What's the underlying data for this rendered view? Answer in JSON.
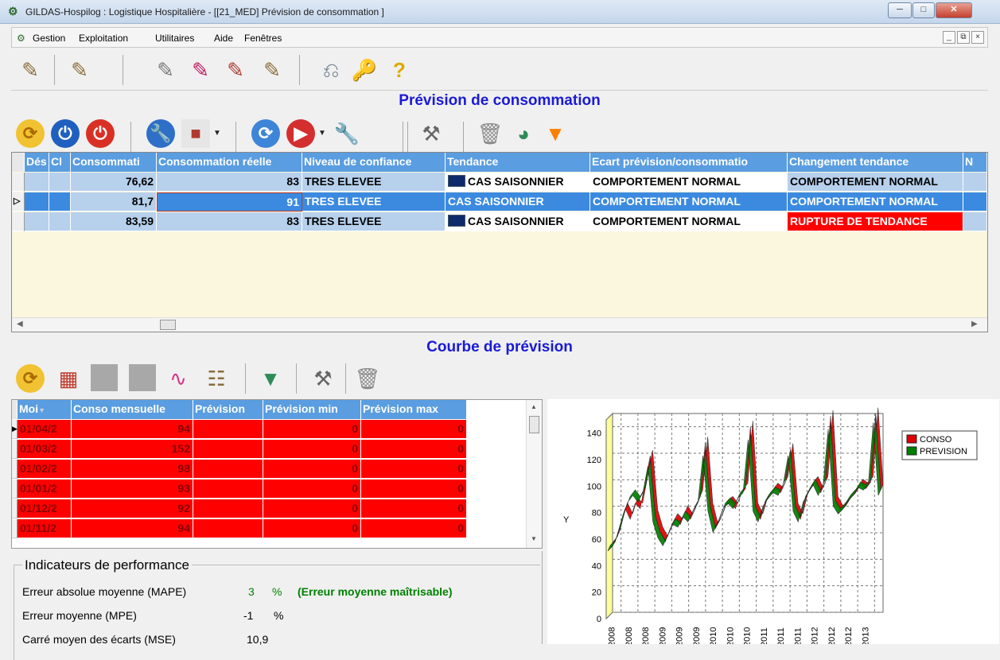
{
  "window": {
    "title": "GILDAS-Hospilog : Logistique Hospitalière - [[21_MED] Prévision de consommation ]"
  },
  "menu": [
    "Gestion",
    "Exploitation",
    "Utilitaires",
    "Aide",
    "Fenêtres"
  ],
  "section1_title": "Prévision de consommation",
  "grid1": {
    "headers": [
      "Dés",
      "Cl",
      "Consommati",
      "Consommation réelle",
      "Niveau de confiance",
      "Tendance",
      "Ecart prévision/consommatio",
      "Changement tendance",
      "N"
    ],
    "rows": [
      {
        "consommation": "76,62",
        "reelle": "83",
        "confiance": "TRES ELEVEE",
        "tendance": "CAS SAISONNIER",
        "ecart": "COMPORTEMENT NORMAL",
        "changement": "COMPORTEMENT NORMAL"
      },
      {
        "consommation": "81,7",
        "reelle": "91",
        "confiance": "TRES ELEVEE",
        "tendance": "CAS SAISONNIER",
        "ecart": "COMPORTEMENT NORMAL",
        "changement": "COMPORTEMENT NORMAL"
      },
      {
        "consommation": "83,59",
        "reelle": "83",
        "confiance": "TRES ELEVEE",
        "tendance": "CAS SAISONNIER",
        "ecart": "COMPORTEMENT NORMAL",
        "changement": "RUPTURE DE TENDANCE"
      }
    ]
  },
  "section2_title": "Courbe de prévision",
  "grid2": {
    "headers": [
      "Moi",
      "Conso mensuelle",
      "Prévision",
      "Prévision min",
      "Prévision max"
    ],
    "rows": [
      {
        "mois": "01/04/2",
        "conso": "94",
        "prevision": "",
        "min": "0",
        "max": "0"
      },
      {
        "mois": "01/03/2",
        "conso": "152",
        "prevision": "",
        "min": "0",
        "max": "0"
      },
      {
        "mois": "01/02/2",
        "conso": "98",
        "prevision": "",
        "min": "0",
        "max": "0"
      },
      {
        "mois": "01/01/2",
        "conso": "93",
        "prevision": "",
        "min": "0",
        "max": "0"
      },
      {
        "mois": "01/12/2",
        "conso": "92",
        "prevision": "",
        "min": "0",
        "max": "0"
      },
      {
        "mois": "01/11/2",
        "conso": "94",
        "prevision": "",
        "min": "0",
        "max": "0"
      }
    ]
  },
  "perf": {
    "title": "Indicateurs de performance",
    "mape_label": "Erreur absolue moyenne (MAPE)",
    "mape_value": "3",
    "mape_unit": "%",
    "mape_comment": "(Erreur moyenne maîtrisable)",
    "mpe_label": "Erreur moyenne (MPE)",
    "mpe_value": "-1",
    "mpe_unit": "%",
    "mse_label": "Carré moyen des écarts (MSE)",
    "mse_value": "10,9"
  },
  "colors": {
    "accent_blue": "#1a1ad6",
    "header_blue": "#5a9de0",
    "red": "#ff0000",
    "green": "#008000"
  },
  "chart_data": {
    "type": "line",
    "ylabel": "Y",
    "ylim": [
      0,
      150
    ],
    "yticks": [
      0,
      20,
      40,
      60,
      80,
      100,
      120,
      140
    ],
    "xticks": [
      "/2008",
      "/2008",
      "/2008",
      "/2009",
      "/2009",
      "/2009",
      "/2010",
      "/2010",
      "/2010",
      "/2011",
      "/2011",
      "/2011",
      "/2012",
      "/2012",
      "/2012",
      "/2013"
    ],
    "legend": [
      "CONSO",
      "PREVISION"
    ],
    "series": [
      {
        "name": "CONSO",
        "color": "#e00000",
        "values": [
          50,
          55,
          68,
          80,
          72,
          84,
          80,
          100,
          120,
          75,
          62,
          55,
          65,
          72,
          68,
          78,
          72,
          80,
          90,
          130,
          80,
          65,
          72,
          82,
          85,
          80,
          90,
          95,
          142,
          80,
          72,
          85,
          90,
          95,
          92,
          100,
          125,
          80,
          72,
          88,
          95,
          100,
          92,
          100,
          150,
          85,
          78,
          82,
          88,
          92,
          98,
          95,
          100,
          152,
          94
        ]
      },
      {
        "name": "PREVISION",
        "color": "#008000",
        "values": [
          48,
          52,
          60,
          75,
          85,
          90,
          85,
          92,
          112,
          70,
          58,
          52,
          60,
          68,
          66,
          74,
          70,
          78,
          85,
          120,
          78,
          62,
          70,
          80,
          84,
          80,
          88,
          92,
          132,
          78,
          70,
          82,
          88,
          92,
          90,
          98,
          120,
          78,
          70,
          85,
          92,
          98,
          90,
          98,
          140,
          82,
          76,
          80,
          86,
          90,
          96,
          94,
          98,
          145,
          90
        ]
      }
    ]
  }
}
